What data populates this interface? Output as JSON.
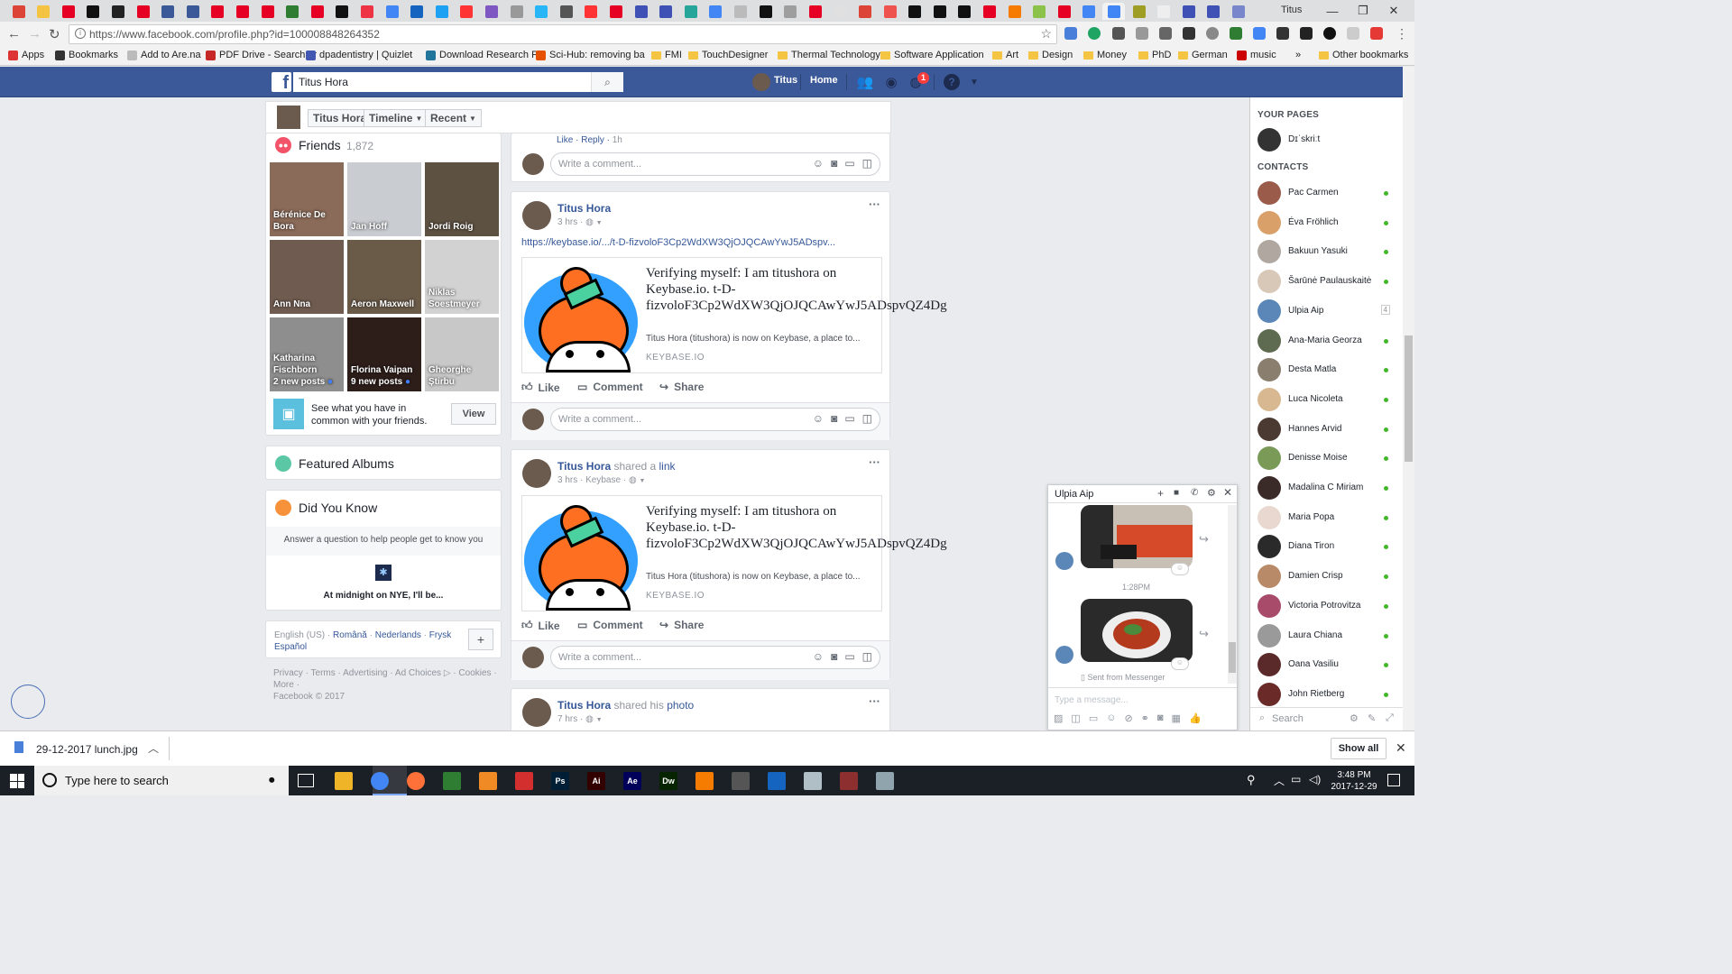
{
  "browser": {
    "url": "https://www.facebook.com/profile.php?id=100008848264352",
    "user": "Titus",
    "tab_icons": [
      "#db4437",
      "#f5c342",
      "#e60023",
      "#111",
      "#222",
      "#e60023",
      "#3b5998",
      "#3b5998",
      "#e60023",
      "#e60023",
      "#e60023",
      "#2e7d32",
      "#e60023",
      "#111",
      "#e34",
      "#4285f4",
      "#1565c0",
      "#1da1f2",
      "#f33",
      "#7e57c2",
      "#999",
      "#29b6f6",
      "#555",
      "#f33",
      "#e60023",
      "#3f51b5",
      "#3f51b5",
      "#26a69a",
      "#4285f4",
      "#bbb",
      "#111",
      "#9e9e9e",
      "#e60023",
      "#e0e0e0",
      "#db4437",
      "#ef5350",
      "#111",
      "#111",
      "#111",
      "#e60023",
      "#f57c00",
      "#8bc34a",
      "#e60023",
      "#4285f4",
      "#4285f4",
      "#9e9d24",
      "#eee",
      "#3f51b5",
      "#3f51b5",
      "#7986cb"
    ],
    "bookmarks": [
      {
        "label": "Apps",
        "type": "apps"
      },
      {
        "label": "Bookmarks",
        "type": "star"
      },
      {
        "label": "Add to Are.na",
        "type": "page"
      },
      {
        "label": "PDF Drive - Search ar",
        "type": "pdf"
      },
      {
        "label": "dpadentistry | Quizlet",
        "type": "q"
      },
      {
        "label": "Download Research P",
        "type": "wp"
      },
      {
        "label": "Sci-Hub: removing ba",
        "type": "sh"
      },
      {
        "label": "FMI",
        "type": "folder"
      },
      {
        "label": "TouchDesigner",
        "type": "folder"
      },
      {
        "label": "Thermal Technology",
        "type": "folder"
      },
      {
        "label": "Software Application",
        "type": "folder"
      },
      {
        "label": "Art",
        "type": "folder"
      },
      {
        "label": "Design",
        "type": "folder"
      },
      {
        "label": "Money",
        "type": "folder"
      },
      {
        "label": "PhD",
        "type": "folder"
      },
      {
        "label": "German",
        "type": "folder"
      },
      {
        "label": "music",
        "type": "yt"
      }
    ],
    "other_bookmarks": "Other bookmarks",
    "overflow": "»"
  },
  "fb": {
    "search_value": "Titus Hora",
    "nav_user": "Titus",
    "nav_home": "Home",
    "notif_count": "1"
  },
  "subnav": {
    "name": "Titus Hora",
    "timeline": "Timeline",
    "recent": "Recent"
  },
  "friends": {
    "title": "Friends",
    "count": "1,872",
    "items": [
      {
        "name": "Bérénice De Bora",
        "sub": "",
        "color": "#8a6a58"
      },
      {
        "name": "Jan Hoff",
        "sub": "",
        "color": "#c9ccd1"
      },
      {
        "name": "Jordi Roig",
        "sub": "",
        "color": "#5d5142"
      },
      {
        "name": "Ann Nna",
        "sub": "",
        "color": "#6f5b4f"
      },
      {
        "name": "Aeron Maxwell",
        "sub": "",
        "color": "#6a5a48"
      },
      {
        "name": "Niklas Soestmeyer",
        "sub": "",
        "color": "#d2d2d2"
      },
      {
        "name": "Katharina Fischborn",
        "sub": "2 new posts",
        "color": "#8e8e8e"
      },
      {
        "name": "Florina Vaipan",
        "sub": "9 new posts",
        "color": "#2d1e1a"
      },
      {
        "name": "Gheorghe Știrbu",
        "sub": "",
        "color": "#c8c8c8"
      }
    ],
    "common_text": "See what you have in common with your friends.",
    "view_label": "View"
  },
  "featured_albums": "Featured Albums",
  "did_you_know": {
    "title": "Did You Know",
    "prompt": "Answer a question to help people get to know you",
    "question": "At midnight on NYE, I'll be..."
  },
  "languages": {
    "current": "English (US)",
    "others": [
      "Română",
      "Nederlands",
      "Frysk",
      "Español"
    ]
  },
  "footer": {
    "links": [
      "Privacy",
      "Terms",
      "Advertising",
      "Ad Choices",
      "Cookies",
      "More"
    ],
    "copyright": "Facebook © 2017"
  },
  "top_comment": {
    "like": "Like",
    "reply": "Reply",
    "time": "1h"
  },
  "comment_placeholder": "Write a comment...",
  "posts": [
    {
      "author": "Titus Hora",
      "action": "",
      "target": "",
      "meta": "3 hrs",
      "link_text": "https://keybase.io/.../t-D-fizvoloF3Cp2WdXW3QjOJQCAwYwJ5ADspv...",
      "card_title": "Verifying myself: I am titushora on Keybase.io. t-D-fizvoloF3Cp2WdXW3QjOJQCAwYwJ5ADspvQZ4Dg",
      "card_desc": "Titus Hora (titushora) is now on Keybase, a place to...",
      "card_domain": "KEYBASE.IO"
    },
    {
      "author": "Titus Hora",
      "action": "shared a",
      "target": "link",
      "meta": "3 hrs · Keybase",
      "link_text": "",
      "card_title": "Verifying myself: I am titushora on Keybase.io. t-D-fizvoloF3Cp2WdXW3QjOJQCAwYwJ5ADspvQZ4Dg",
      "card_desc": "Titus Hora (titushora) is now on Keybase, a place to...",
      "card_domain": "KEYBASE.IO"
    },
    {
      "author": "Titus Hora",
      "action": "shared his",
      "target": "photo",
      "meta": "7 hrs"
    }
  ],
  "actions": {
    "like": "Like",
    "comment": "Comment",
    "share": "Share"
  },
  "sidebar": {
    "your_pages": "YOUR PAGES",
    "page_name": "Dɪˈskriːt",
    "contacts_label": "CONTACTS",
    "contacts": [
      {
        "name": "Pac Carmen",
        "color": "#9a5b4b",
        "status": "online"
      },
      {
        "name": "Éva Fröhlich",
        "color": "#d9a06a",
        "status": "online"
      },
      {
        "name": "Bakuun Yasuki",
        "color": "#b0a8a0",
        "status": "online"
      },
      {
        "name": "Šarūnė Paulauskaitė",
        "color": "#d8c8b8",
        "status": "online"
      },
      {
        "name": "Ulpia Aip",
        "color": "#5a86b8",
        "status": "count",
        "count": "4"
      },
      {
        "name": "Ana-Maria Georza",
        "color": "#5e6b50",
        "status": "online"
      },
      {
        "name": "Desta Matla",
        "color": "#8a7e6e",
        "status": "online"
      },
      {
        "name": "Luca Nicoleta",
        "color": "#d8b890",
        "status": "online"
      },
      {
        "name": "Hannes Arvid",
        "color": "#4a3a32",
        "status": "online"
      },
      {
        "name": "Denisse Moise",
        "color": "#7a9a58",
        "status": "online"
      },
      {
        "name": "Madalina C Miriam",
        "color": "#3a2a28",
        "status": "online"
      },
      {
        "name": "Maria Popa",
        "color": "#e8d8d0",
        "status": "online"
      },
      {
        "name": "Diana Tiron",
        "color": "#2a2a2a",
        "status": "online"
      },
      {
        "name": "Damien Crisp",
        "color": "#b88a68",
        "status": "online"
      },
      {
        "name": "Victoria Potrovitza",
        "color": "#a84a6a",
        "status": "online"
      },
      {
        "name": "Laura Chiana",
        "color": "#9a9a9a",
        "status": "online"
      },
      {
        "name": "Oana Vasiliu",
        "color": "#5a2a2a",
        "status": "online"
      },
      {
        "name": "John Rietberg",
        "color": "#6a2a28",
        "status": "online"
      }
    ],
    "search_placeholder": "Search"
  },
  "chat": {
    "name": "Ulpia Aip",
    "time": "1:28PM",
    "sent_from": "Sent from Messenger",
    "placeholder": "Type a message..."
  },
  "download": {
    "file": "29-12-2017 lunch.jpg",
    "show_all": "Show all"
  },
  "taskbar": {
    "search_placeholder": "Type here to search",
    "time": "3:48 PM",
    "date": "2017-12-29",
    "apps": [
      {
        "label": "",
        "color": "#f0b429"
      },
      {
        "label": "",
        "color": "#4285f4"
      },
      {
        "label": "",
        "color": "#ff7139"
      },
      {
        "label": "",
        "color": "#2e7d32"
      },
      {
        "label": "",
        "color": "#f08a24"
      },
      {
        "label": "",
        "color": "#d32f2f"
      },
      {
        "label": "Ps",
        "color": "#001e36"
      },
      {
        "label": "Ai",
        "color": "#330000"
      },
      {
        "label": "Ae",
        "color": "#00005b"
      },
      {
        "label": "Dw",
        "color": "#072401"
      },
      {
        "label": "",
        "color": "#f57c00"
      },
      {
        "label": "",
        "color": "#555"
      },
      {
        "label": "",
        "color": "#1565c0"
      },
      {
        "label": "",
        "color": "#b0bec5"
      },
      {
        "label": "",
        "color": "#8d2f2f"
      },
      {
        "label": "",
        "color": "#90a4ae"
      }
    ]
  }
}
